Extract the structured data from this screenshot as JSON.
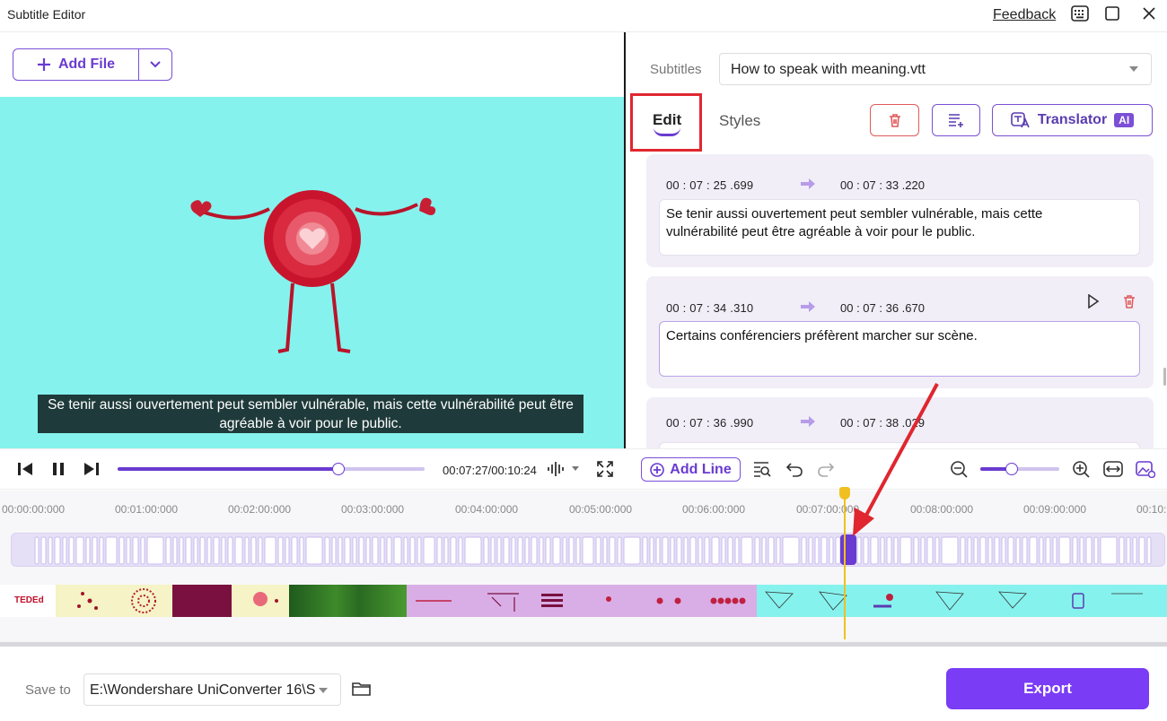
{
  "window": {
    "title": "Subtitle Editor",
    "feedback_label": "Feedback"
  },
  "toolbar": {
    "add_file_label": "Add File"
  },
  "preview": {
    "caption_line1": "Se tenir aussi ouvertement peut sembler vulnérable, mais cette vulnérabilité peut être",
    "caption_line2": "agréable à voir pour le public."
  },
  "subtitles_panel": {
    "label": "Subtitles",
    "selected_file": "How to speak with meaning.vtt",
    "tabs": [
      {
        "label": "Edit",
        "active": true
      },
      {
        "label": "Styles",
        "active": false
      }
    ],
    "translator_label": "Translator",
    "ai_badge": "AI",
    "entries": [
      {
        "start": "00 : 07 : 25 .699",
        "end": "00 : 07 : 33 .220",
        "text_line1": "Se tenir aussi ouvertement peut sembler vulnérable, mais cette",
        "text_line2": "vulnérabilité peut être agréable à voir pour le public."
      },
      {
        "start": "00 : 07 : 34 .310",
        "end": "00 : 07 : 36 .670",
        "text_line1": "Certains conférenciers préfèrent marcher sur scène."
      },
      {
        "start": "00 : 07 : 36 .990",
        "end": "00 : 07 : 38 .029"
      }
    ]
  },
  "player": {
    "time_readout": "00:07:27/00:10:24",
    "progress": 0.72,
    "add_line_label": "Add Line",
    "zoom_level": 0.4
  },
  "timeline": {
    "ruler": [
      "00:00:00:000",
      "00:01:00:000",
      "00:02:00:000",
      "00:03:00:000",
      "00:04:00:000",
      "00:05:00:000",
      "00:06:00:000",
      "00:07:00:000",
      "00:08:00:000",
      "00:09:00:000",
      "00:10:"
    ],
    "thumb_label": "TEDEd"
  },
  "footer": {
    "save_to_label": "Save to",
    "save_path": "E:\\Wondershare UniConverter 16\\S",
    "export_label": "Export"
  },
  "colors": {
    "accent": "#6a3bd0",
    "export": "#7a3cf5",
    "preview_bg": "#86f2ee",
    "highlight_box": "#e0262f",
    "playhead": "#f0c020"
  }
}
